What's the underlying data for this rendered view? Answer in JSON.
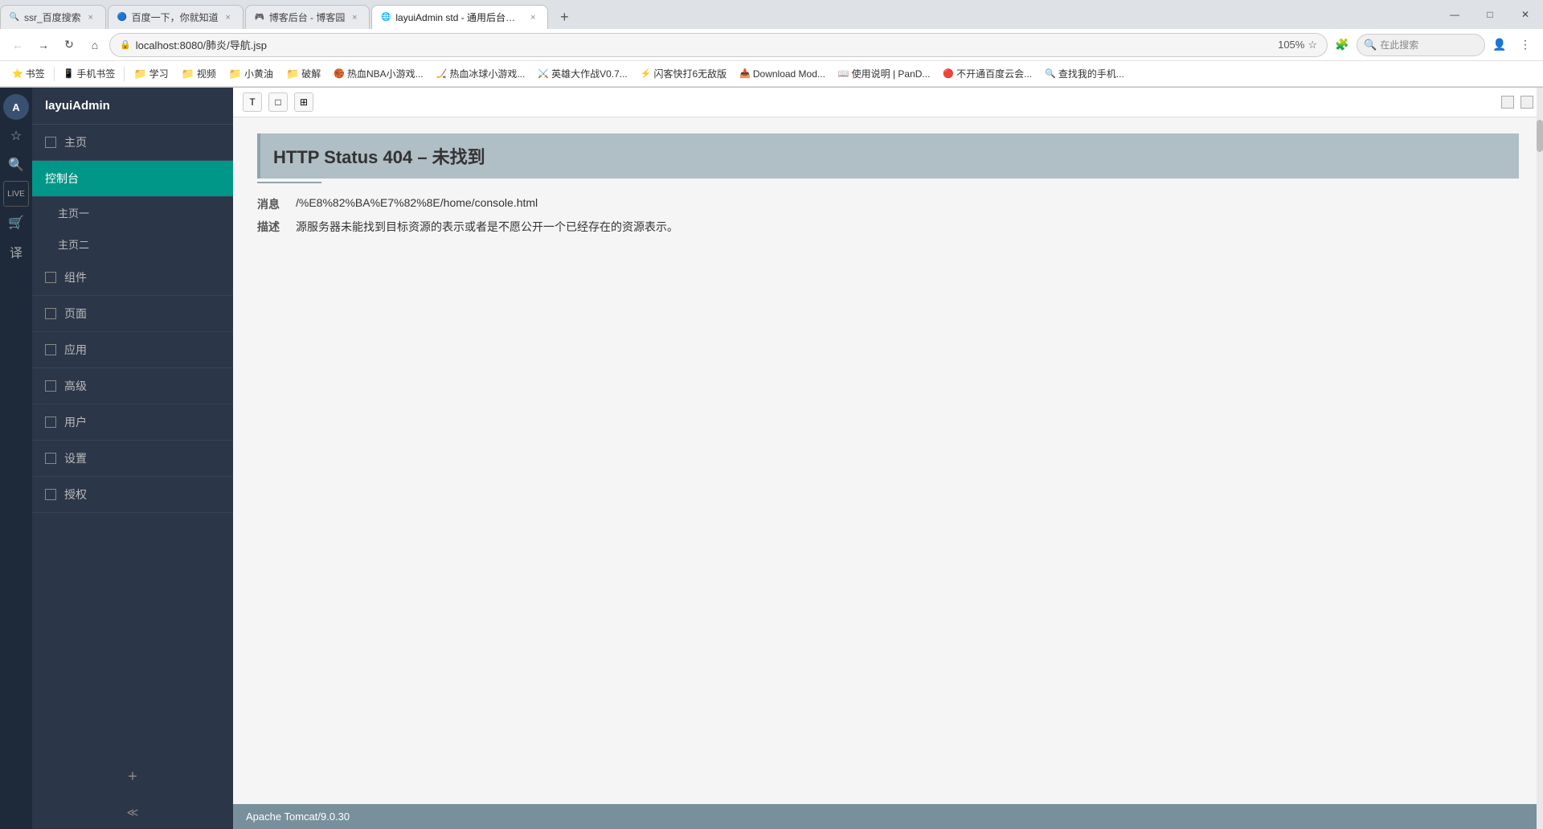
{
  "browser": {
    "tabs": [
      {
        "id": "tab1",
        "favicon": "🔍",
        "label": "ssr_百度搜索",
        "active": false
      },
      {
        "id": "tab2",
        "favicon": "🔵",
        "label": "百度一下，你就知道",
        "active": false
      },
      {
        "id": "tab3",
        "favicon": "🎮",
        "label": "博客后台 - 博客园",
        "active": false
      },
      {
        "id": "tab4",
        "favicon": "🌐",
        "label": "layuiAdmin std - 通用后台管理模板",
        "active": true
      }
    ],
    "address": "localhost:8080/肺炎/导航.jsp",
    "zoom": "105%",
    "search_placeholder": "在此搜索"
  },
  "bookmarks": [
    {
      "id": "bk1",
      "type": "folder",
      "icon": "⭐",
      "label": "书签"
    },
    {
      "id": "bk2",
      "type": "item",
      "icon": "📱",
      "label": "手机书签"
    },
    {
      "id": "bk3",
      "type": "folder",
      "icon": "📁",
      "label": "学习"
    },
    {
      "id": "bk4",
      "type": "folder",
      "icon": "📁",
      "label": "视频"
    },
    {
      "id": "bk5",
      "type": "folder",
      "icon": "📁",
      "label": "小黄油"
    },
    {
      "id": "bk6",
      "type": "folder",
      "icon": "📁",
      "label": "破解"
    },
    {
      "id": "bk7",
      "type": "item",
      "icon": "🏀",
      "label": "热血NBA小游戏..."
    },
    {
      "id": "bk8",
      "type": "item",
      "icon": "🏒",
      "label": "热血冰球小游戏..."
    },
    {
      "id": "bk9",
      "type": "item",
      "icon": "⚔️",
      "label": "英雄大作战V0.7..."
    },
    {
      "id": "bk10",
      "type": "item",
      "icon": "⚡",
      "label": "闪客快打6无敌版"
    },
    {
      "id": "bk11",
      "type": "item",
      "icon": "📥",
      "label": "Download Mod..."
    },
    {
      "id": "bk12",
      "type": "item",
      "icon": "📖",
      "label": "使用说明 | PanD..."
    },
    {
      "id": "bk13",
      "type": "item",
      "icon": "🔴",
      "label": "不开通百度云会..."
    },
    {
      "id": "bk14",
      "type": "item",
      "icon": "🔍",
      "label": "查找我的手机..."
    }
  ],
  "sidebar": {
    "app_name": "layuiAdmin",
    "menu_items": [
      {
        "id": "home",
        "label": "主页",
        "has_checkbox": true,
        "active": false,
        "has_sub": false
      },
      {
        "id": "dashboard",
        "label": "控制台",
        "has_checkbox": false,
        "active": true,
        "has_sub": false
      },
      {
        "id": "sub_home1",
        "label": "主页一",
        "is_sub": true
      },
      {
        "id": "sub_home2",
        "label": "主页二",
        "is_sub": true
      },
      {
        "id": "components",
        "label": "组件",
        "has_checkbox": true,
        "active": false,
        "has_sub": false
      },
      {
        "id": "pages",
        "label": "页面",
        "has_checkbox": true,
        "active": false,
        "has_sub": false
      },
      {
        "id": "applications",
        "label": "应用",
        "has_checkbox": true,
        "active": false,
        "has_sub": false
      },
      {
        "id": "advanced",
        "label": "高级",
        "has_checkbox": true,
        "active": false,
        "has_sub": false
      },
      {
        "id": "users",
        "label": "用户",
        "has_checkbox": true,
        "active": false,
        "has_sub": false
      },
      {
        "id": "settings",
        "label": "设置",
        "has_checkbox": true,
        "active": false,
        "has_sub": false
      },
      {
        "id": "auth",
        "label": "授权",
        "has_checkbox": true,
        "active": false,
        "has_sub": false
      }
    ]
  },
  "content": {
    "http_error": {
      "title": "HTTP Status 404 – 未找到",
      "type_label": "消息",
      "type_value": "/‌%E8%82%BA%E7%82%8E/home/console.html",
      "desc_label": "描述",
      "desc_value": "源服务器未能找到目标资源的表示或者是不愿公开一个已经存在的资源表示。",
      "footer": "Apache Tomcat/9.0.30"
    }
  },
  "window_controls": {
    "minimize": "—",
    "maximize": "□",
    "close": "✕"
  }
}
